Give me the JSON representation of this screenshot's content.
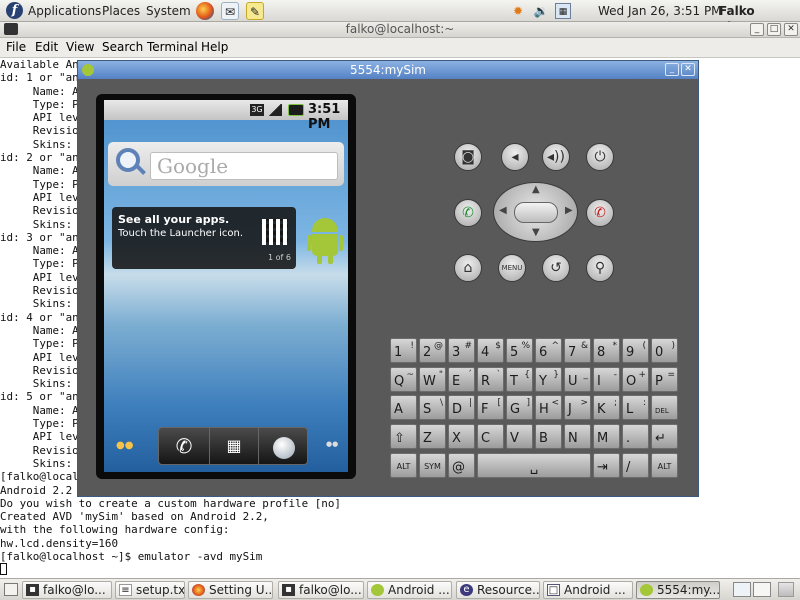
{
  "top_panel": {
    "menus": [
      "Applications",
      "Places",
      "System"
    ],
    "clock": "Wed Jan 26,  3:51 PM",
    "user": "Falko Timme",
    "icons": [
      "fedora-logo-icon",
      "firefox-icon",
      "mail-icon",
      "notes-icon",
      "update-alert-icon",
      "volume-icon",
      "network-icon"
    ]
  },
  "terminal": {
    "title": "falko@localhost:~",
    "menu": [
      "File",
      "Edit",
      "View",
      "Search",
      "Terminal",
      "Help"
    ],
    "lines": [
      "Available An",
      "id: 1 or \"an",
      "     Name: A",
      "     Type: P",
      "     API lev",
      "     Revisio",
      "     Skins:",
      "id: 2 or \"an",
      "     Name: A",
      "     Type: P",
      "     API lev",
      "     Revisio",
      "     Skins:",
      "id: 3 or \"an",
      "     Name: A",
      "     Type: P",
      "     API lev",
      "     Revisio",
      "     Skins:",
      "id: 4 or \"an",
      "     Name: A",
      "     Type: P",
      "     API lev",
      "     Revisio",
      "     Skins:",
      "id: 5 or \"an",
      "     Name: A",
      "     Type: P",
      "     API lev",
      "     Revisio",
      "     Skins:",
      "[falko@localh",
      "Android 2.2",
      "Do you wish to create a custom hardware profile [no]",
      "Created AVD 'mySim' based on Android 2.2,",
      "with the following hardware config:",
      "hw.lcd.density=160",
      "[falko@localhost ~]$ emulator -avd mySim"
    ]
  },
  "emulator": {
    "title": "5554:mySim",
    "status_time": "3:51 PM",
    "network_badge": "3G",
    "search_placeholder": "Google",
    "tip_title": "See all your apps.",
    "tip_text": "Touch the Launcher icon.",
    "tip_page": "1 of 6",
    "menu_label": "MENU",
    "keyboard_rows": [
      [
        {
          "k": "1",
          "s": "!"
        },
        {
          "k": "2",
          "s": "@"
        },
        {
          "k": "3",
          "s": "#"
        },
        {
          "k": "4",
          "s": "$"
        },
        {
          "k": "5",
          "s": "%"
        },
        {
          "k": "6",
          "s": "^"
        },
        {
          "k": "7",
          "s": "&"
        },
        {
          "k": "8",
          "s": "*"
        },
        {
          "k": "9",
          "s": "("
        },
        {
          "k": "0",
          "s": ")"
        }
      ],
      [
        {
          "k": "Q",
          "s": "~"
        },
        {
          "k": "W",
          "s": "\""
        },
        {
          "k": "E",
          "s": "´"
        },
        {
          "k": "R",
          "s": "`"
        },
        {
          "k": "T",
          "s": "{"
        },
        {
          "k": "Y",
          "s": "}"
        },
        {
          "k": "U",
          "s": "_"
        },
        {
          "k": "I",
          "s": "-"
        },
        {
          "k": "O",
          "s": "+"
        },
        {
          "k": "P",
          "s": "="
        }
      ],
      [
        {
          "k": "A",
          "s": ""
        },
        {
          "k": "S",
          "s": "\\"
        },
        {
          "k": "D",
          "s": "|"
        },
        {
          "k": "F",
          "s": "["
        },
        {
          "k": "G",
          "s": "]"
        },
        {
          "k": "H",
          "s": "<"
        },
        {
          "k": "J",
          "s": ">"
        },
        {
          "k": "K",
          "s": ";"
        },
        {
          "k": "L",
          "s": ":"
        },
        {
          "k": "DEL",
          "s": ""
        }
      ],
      [
        {
          "k": "⇧",
          "s": ""
        },
        {
          "k": "Z",
          "s": ""
        },
        {
          "k": "X",
          "s": ""
        },
        {
          "k": "C",
          "s": ""
        },
        {
          "k": "V",
          "s": ""
        },
        {
          "k": "B",
          "s": ""
        },
        {
          "k": "N",
          "s": ""
        },
        {
          "k": "M",
          "s": ""
        },
        {
          "k": ".",
          "s": ""
        },
        {
          "k": "↵",
          "s": ""
        }
      ]
    ],
    "bottom_row": {
      "alt_left": "ALT",
      "sym": "SYM",
      "at": "@",
      "slash": "/",
      "alt_right": "ALT"
    }
  },
  "taskbar": {
    "tasks": [
      {
        "label": "falko@lo...",
        "icon": "terminal-icon"
      },
      {
        "label": "setup.txt...",
        "icon": "text-file-icon"
      },
      {
        "label": "Setting U...",
        "icon": "firefox-icon"
      },
      {
        "label": "falko@lo...",
        "icon": "terminal-icon"
      },
      {
        "label": "Android ...",
        "icon": "android-icon"
      },
      {
        "label": "Resource...",
        "icon": "eclipse-icon"
      },
      {
        "label": "Android ...",
        "icon": "window-icon"
      },
      {
        "label": "5554:my...",
        "icon": "android-icon"
      }
    ]
  }
}
